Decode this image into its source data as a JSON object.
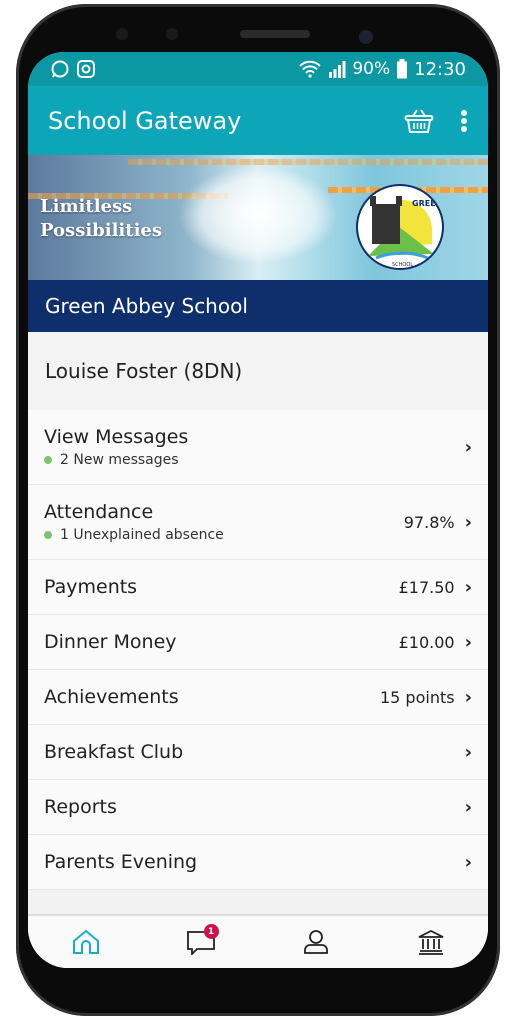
{
  "status": {
    "battery": "90%",
    "time": "12:30",
    "icons": [
      "whatsapp-icon",
      "instagram-icon",
      "wifi-icon",
      "signal-icon",
      "battery-icon"
    ]
  },
  "app": {
    "title": "School Gateway",
    "accent": "#0ca6b8"
  },
  "banner": {
    "tagline_1": "Limitless",
    "tagline_2": "Possibilities",
    "school": "Green Abbey School",
    "logo_text": "GREEN ABBEY",
    "logo_sub": "SCHOOL"
  },
  "student": "Louise Foster (8DN)",
  "items": [
    {
      "label": "View Messages",
      "sub": "2 New messages",
      "value": ""
    },
    {
      "label": "Attendance",
      "sub": "1 Unexplained absence",
      "value": "97.8%"
    },
    {
      "label": "Payments",
      "value": "£17.50"
    },
    {
      "label": "Dinner Money",
      "value": "£10.00"
    },
    {
      "label": "Achievements",
      "value": "15 points"
    },
    {
      "label": "Breakfast Club",
      "value": ""
    },
    {
      "label": "Reports",
      "value": ""
    },
    {
      "label": "Parents Evening",
      "value": ""
    }
  ],
  "nav": {
    "messages_badge": "1",
    "items": [
      "home-icon",
      "messages-icon",
      "profile-icon",
      "bank-icon"
    ]
  }
}
